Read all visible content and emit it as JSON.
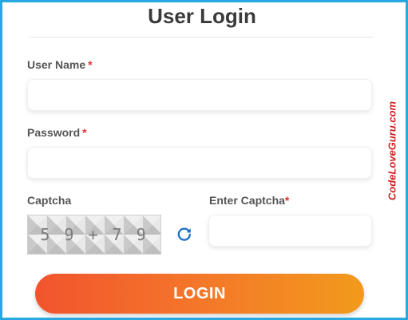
{
  "form": {
    "title": "User Login",
    "username_label": "User Name",
    "username_value": "",
    "password_label": "Password",
    "password_value": "",
    "required_marker": "*",
    "captcha_label": "Captcha",
    "captcha_text": "5 9 + 7 9",
    "enter_captcha_label": "Enter Captcha",
    "captcha_input_value": "",
    "login_label": "LOGIN"
  },
  "watermark": "CodeLoveGuru.com",
  "colors": {
    "frame_border": "#29a8e0",
    "required": "#e03030",
    "refresh_icon": "#1f73c7",
    "button_gradient": [
      "#f2542d",
      "#f29a1c"
    ],
    "watermark": "#d42020"
  },
  "icons": {
    "refresh": "refresh-icon"
  }
}
